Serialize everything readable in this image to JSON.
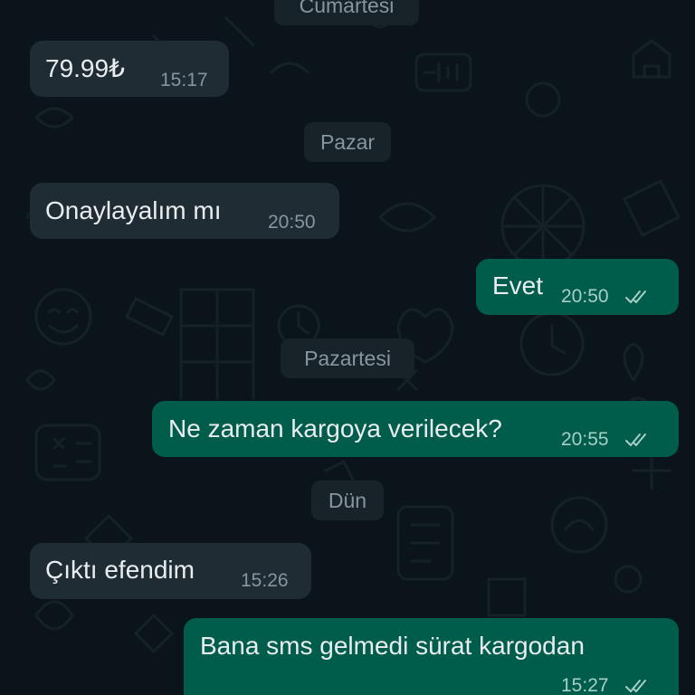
{
  "date_separators": {
    "cumartesi": "Cumartesi",
    "pazar": "Pazar",
    "pazartesi": "Pazartesi",
    "dun": "Dün"
  },
  "messages": [
    {
      "direction": "incoming",
      "text": "79.99₺",
      "time": "15:17"
    },
    {
      "direction": "incoming",
      "text": "Onaylayalım mı",
      "time": "20:50"
    },
    {
      "direction": "outgoing",
      "text": "Evet",
      "time": "20:50",
      "status": "read"
    },
    {
      "direction": "outgoing",
      "text": "Ne zaman kargoya verilecek?",
      "time": "20:55",
      "status": "read"
    },
    {
      "direction": "incoming",
      "text": "Çıktı efendim",
      "time": "15:26"
    },
    {
      "direction": "outgoing",
      "text": "Bana sms gelmedi sürat kargodan",
      "time": "15:27",
      "status": "read"
    }
  ],
  "colors": {
    "background": "#0b141a",
    "incoming_bubble": "#202c33",
    "outgoing_bubble": "#005c4b",
    "date_chip": "#182229",
    "meta_text": "#8696a0",
    "read_tick": "#a8cfc6"
  },
  "icons": {
    "read_receipt": "double-check-icon"
  }
}
